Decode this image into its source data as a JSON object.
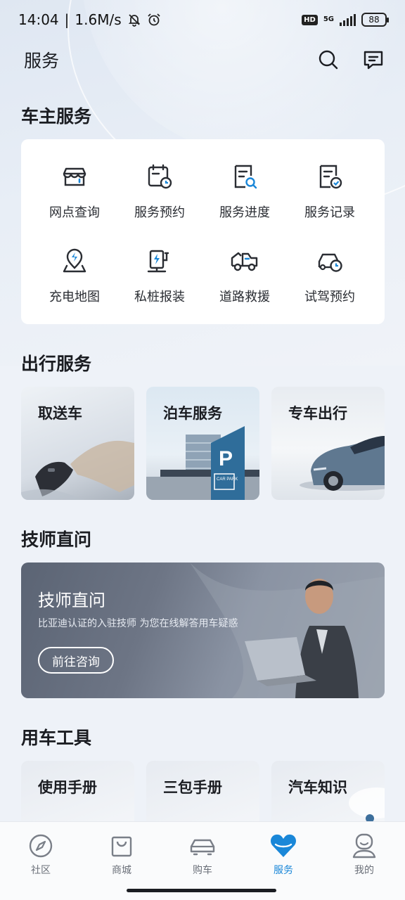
{
  "status_bar": {
    "time": "14:04",
    "speed": "1.6M/s",
    "hd": "HD",
    "network": "5G",
    "battery": "88"
  },
  "header": {
    "title": "服务"
  },
  "owner_services": {
    "title": "车主服务",
    "items": [
      {
        "label": "网点查询",
        "icon": "store-icon"
      },
      {
        "label": "服务预约",
        "icon": "calendar-clock-icon"
      },
      {
        "label": "服务进度",
        "icon": "document-search-icon"
      },
      {
        "label": "服务记录",
        "icon": "document-check-icon"
      },
      {
        "label": "充电地图",
        "icon": "charging-pin-icon"
      },
      {
        "label": "私桩报装",
        "icon": "charger-post-icon"
      },
      {
        "label": "道路救援",
        "icon": "tow-truck-icon"
      },
      {
        "label": "试驾预约",
        "icon": "car-clock-icon"
      }
    ]
  },
  "travel_services": {
    "title": "出行服务",
    "cards": [
      {
        "label": "取送车"
      },
      {
        "label": "泊车服务",
        "sign": "P",
        "sign_text": "CAR PARK"
      },
      {
        "label": "专车出行"
      }
    ]
  },
  "technician": {
    "section_title": "技师直问",
    "banner_title": "技师直问",
    "subtitle": "比亚迪认证的入驻技师 为您在线解答用车疑惑",
    "button": "前往咨询"
  },
  "car_tools": {
    "title": "用车工具",
    "cards": [
      {
        "label": "使用手册"
      },
      {
        "label": "三包手册"
      },
      {
        "label": "汽车知识"
      }
    ]
  },
  "bottom_nav": {
    "items": [
      {
        "label": "社区",
        "icon": "compass-icon"
      },
      {
        "label": "商城",
        "icon": "shopping-bag-icon"
      },
      {
        "label": "购车",
        "icon": "car-icon"
      },
      {
        "label": "服务",
        "icon": "heart-icon",
        "active": true
      },
      {
        "label": "我的",
        "icon": "profile-icon"
      }
    ]
  },
  "colors": {
    "accent": "#1a87d8",
    "background": "#eef2f8"
  }
}
